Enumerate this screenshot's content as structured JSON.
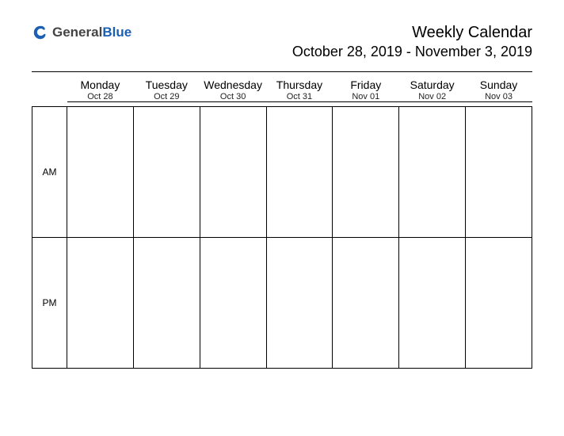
{
  "logo": {
    "text_general": "General",
    "text_blue": "Blue"
  },
  "header": {
    "title": "Weekly Calendar",
    "date_range": "October 28, 2019 - November 3, 2019"
  },
  "days": [
    {
      "dow": "Monday",
      "date": "Oct 28"
    },
    {
      "dow": "Tuesday",
      "date": "Oct 29"
    },
    {
      "dow": "Wednesday",
      "date": "Oct 30"
    },
    {
      "dow": "Thursday",
      "date": "Oct 31"
    },
    {
      "dow": "Friday",
      "date": "Nov 01"
    },
    {
      "dow": "Saturday",
      "date": "Nov 02"
    },
    {
      "dow": "Sunday",
      "date": "Nov 03"
    }
  ],
  "periods": {
    "am": "AM",
    "pm": "PM"
  }
}
